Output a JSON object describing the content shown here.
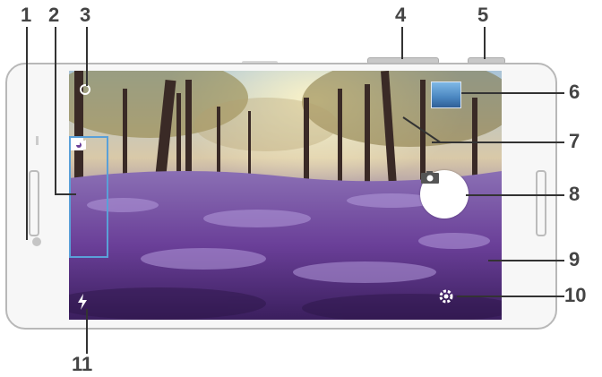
{
  "callouts": {
    "n1": "1",
    "n2": "2",
    "n3": "3",
    "n4": "4",
    "n5": "5",
    "n6": "6",
    "n7": "7",
    "n8": "8",
    "n9": "9",
    "n10": "10",
    "n11": "11"
  },
  "icons": {
    "zoom": "zoom-icon",
    "video_mode": "video-camera-icon",
    "photo_mode": "camera-icon",
    "manual_mode": "manual-mode-icon",
    "thumbnail": "gallery-thumbnail",
    "shutter": "camera-shutter-icon",
    "settings": "gear-icon",
    "flash": "flash-icon"
  },
  "colors": {
    "mode_panel_border": "#5aa0d8",
    "callout_text": "#444444"
  }
}
